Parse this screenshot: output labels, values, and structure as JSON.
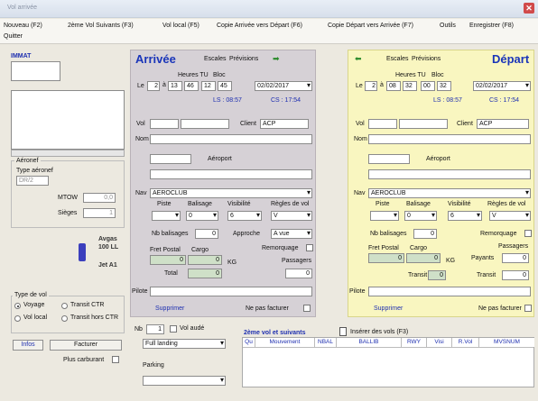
{
  "window": {
    "title": "Vol arrivée"
  },
  "menu": [
    "Nouveau (F2)",
    "2ème Vol Suivants (F3)",
    "Vol local (F5)",
    "Copie Arrivée vers Départ (F6)",
    "Copie Départ vers Arrivée (F7)",
    "Outils",
    "Enregistrer (F8)",
    "Quitter"
  ],
  "left": {
    "immat_label": "IMMAT",
    "aircraft_group": "Aéronef",
    "type_label": "Type aéronef",
    "type_value": "DR/2",
    "mtow_label": "MTOW",
    "mtow_value": "0,0",
    "seats_label": "Sièges",
    "seats_value": "1",
    "info_line1": "Avgas",
    "info_line2": "100 LL",
    "info_line3": "Jet A1",
    "flight_type_group": "Type de vol",
    "flight_types": [
      "Voyage",
      "Transit CTR",
      "Vol local",
      "Transit hors CTR"
    ],
    "selected_flight_type": "Voyage",
    "infos_button": "Infos",
    "invoice_button": "Facturer",
    "fuel_label": "Plus carburant"
  },
  "arrival": {
    "title": "Arrivée",
    "tab_ports": "Escales",
    "tab_forecast": "Prévisions",
    "hours_label": "Heures TU",
    "block_label": "Bloc",
    "le_label": "Le",
    "day_value": "2",
    "a_label": "à",
    "hour_h": "13",
    "hour_m": "46",
    "block_h": "12",
    "block_m": "45",
    "date_value": "02/02/2017",
    "ls_text": "LS : 08:57",
    "cs_text": "CS : 17:54",
    "vol_label": "Vol",
    "client_label": "Client",
    "client_value": "ACP",
    "nom_label": "Nom",
    "aeroport_label": "Aéroport",
    "nav_label": "Nav",
    "nav_value": "AEROCLUB",
    "piste_label": "Piste",
    "balisage_label": "Balisage",
    "visib_label": "Visibilité",
    "regles_label": "Règles de vol",
    "balisage_value": "0",
    "visib_value": "6",
    "regles_value": "V",
    "nb_bal_label": "Nb balisages",
    "nb_bal_value": "0",
    "approche_label": "Approche",
    "approche_value": "A vue",
    "remorquage_label": "Remorquage",
    "fret_label": "Fret Postal",
    "cargo_label": "Cargo",
    "fret_value": "0",
    "cargo_value": "0",
    "kg_label": "KG",
    "passagers_label": "Passagers",
    "pass_value": "0",
    "total_label": "Total",
    "total_value": "0",
    "pilote_label": "Pilote",
    "supprimer": "Supprimer",
    "ne_pas_facturer": "Ne pas facturer"
  },
  "departure": {
    "title": "Départ",
    "tab_ports": "Escales",
    "tab_forecast": "Prévisions",
    "hours_label": "Heures TU",
    "block_label": "Bloc",
    "le_label": "Le",
    "day_value": "2",
    "a_label": "à",
    "hour_h": "08",
    "hour_m": "32",
    "block_h": "00",
    "block_m": "32",
    "date_value": "02/02/2017",
    "ls_text": "LS : 08:57",
    "cs_text": "CS : 17:54",
    "vol_label": "Vol",
    "client_label": "Client",
    "client_value": "ACP",
    "nom_label": "Nom",
    "aeroport_label": "Aéroport",
    "nav_label": "Nav",
    "nav_value": "AEROCLUB",
    "piste_label": "Piste",
    "balisage_label": "Balisage",
    "visib_label": "Visibilité",
    "regles_label": "Règles de vol",
    "balisage_value": "0",
    "visib_value": "6",
    "regles_value": "V",
    "nb_bal_label": "Nb balisages",
    "nb_bal_value": "0",
    "remorquage_label": "Remorquage",
    "fret_label": "Fret Postal",
    "cargo_label": "Cargo",
    "fret_value": "0",
    "cargo_value": "0",
    "kg_label": "KG",
    "passagers_label": "Passagers",
    "payants_label": "Payants",
    "payants_value": "0",
    "transit_label": "Transit",
    "transit_value": "0",
    "transit2_label": "Transit",
    "transit2_value": "0",
    "pilote_label": "Pilote",
    "supprimer": "Supprimer",
    "ne_pas_facturer": "Ne pas facturer"
  },
  "bottom": {
    "nb_label": "Nb",
    "nb_value": "1",
    "vol_aude_label": "Vol audé",
    "landing_value": "Full landing",
    "parking_label": "Parking",
    "second_flight_label": "2ème vol et suivants",
    "insert_label": "Insérer des vols (F3)",
    "columns": [
      "Qu",
      "Mouvement",
      "NBAL",
      "BALLIB",
      "RWY",
      "Visi",
      "R.Vol",
      "MVSNUM"
    ]
  }
}
